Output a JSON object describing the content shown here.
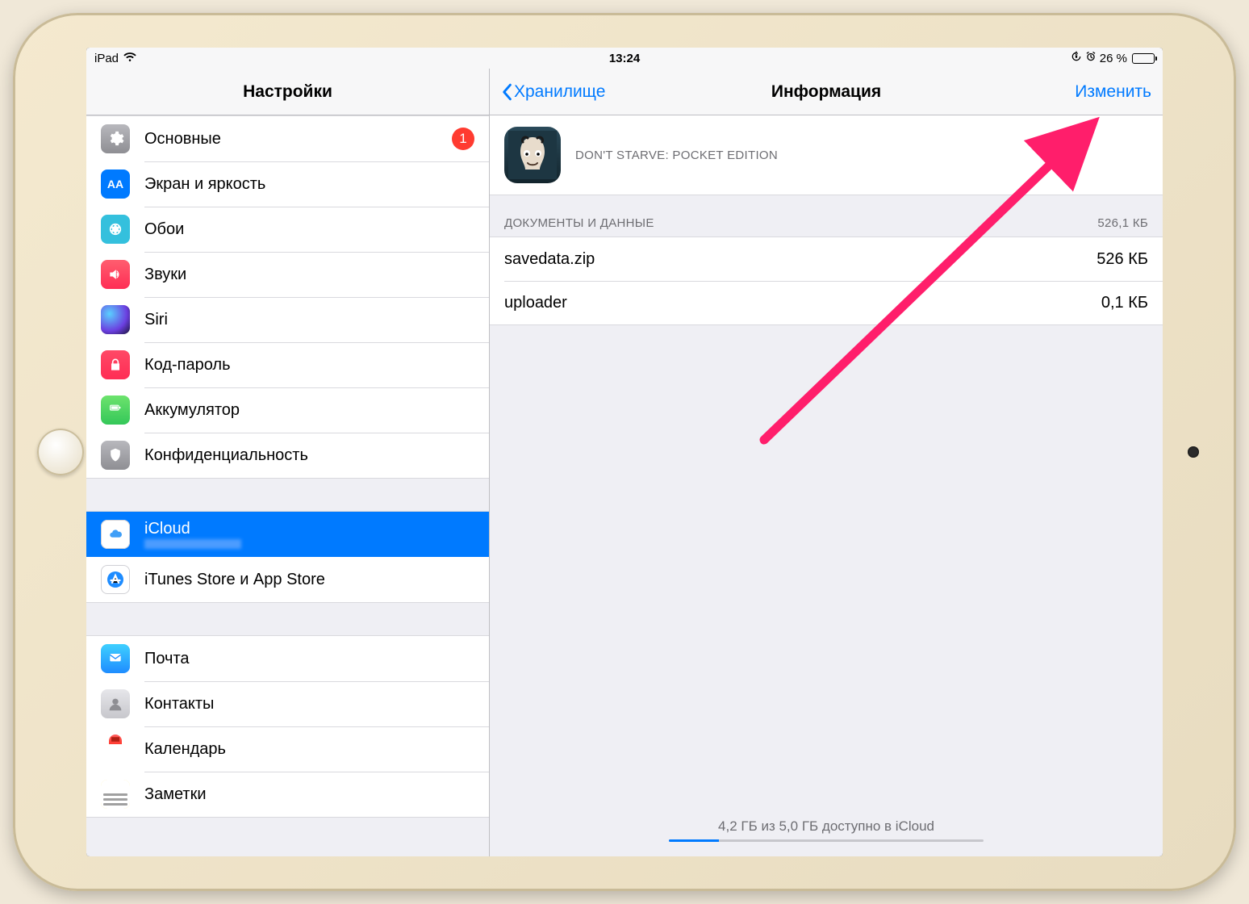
{
  "status": {
    "device": "iPad",
    "time": "13:24",
    "battery_text": "26 %"
  },
  "sidebar": {
    "title": "Настройки",
    "items": {
      "general": {
        "label": "Основные",
        "badge": "1"
      },
      "display": {
        "label": "Экран и яркость"
      },
      "wallpaper": {
        "label": "Обои"
      },
      "sounds": {
        "label": "Звуки"
      },
      "siri": {
        "label": "Siri"
      },
      "passcode": {
        "label": "Код-пароль"
      },
      "battery": {
        "label": "Аккумулятор"
      },
      "privacy": {
        "label": "Конфиденциальность"
      },
      "icloud": {
        "label": "iCloud",
        "sub": ""
      },
      "itunes": {
        "label": "iTunes Store и App Store"
      },
      "mail": {
        "label": "Почта"
      },
      "contacts": {
        "label": "Контакты"
      },
      "calendar": {
        "label": "Календарь"
      },
      "notes": {
        "label": "Заметки"
      }
    }
  },
  "detail": {
    "back": "Хранилище",
    "title": "Информация",
    "edit": "Изменить",
    "app_name": "DON'T STARVE: POCKET EDITION",
    "section_header": "ДОКУМЕНТЫ И ДАННЫЕ",
    "section_total": "526,1 КБ",
    "files": [
      {
        "name": "savedata.zip",
        "size": "526 КБ"
      },
      {
        "name": "uploader",
        "size": "0,1 КБ"
      }
    ],
    "storage_footer": "4,2 ГБ из 5,0 ГБ доступно в iCloud"
  }
}
